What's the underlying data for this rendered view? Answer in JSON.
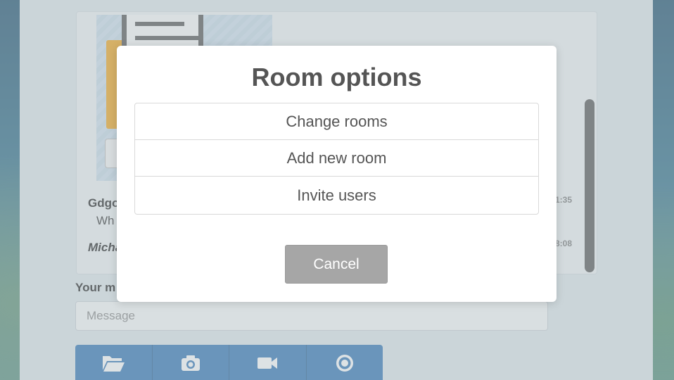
{
  "chat": {
    "messages": [
      {
        "sender": "Gdgo",
        "text": "Wh",
        "time": "1:35"
      },
      {
        "sender": "Micha",
        "time": "8:08"
      }
    ]
  },
  "compose": {
    "label": "Your m",
    "placeholder": "Message"
  },
  "toolbar": {
    "icons": [
      "folder-open-icon",
      "camera-icon",
      "video-camera-icon",
      "record-icon"
    ]
  },
  "modal": {
    "title": "Room options",
    "options": [
      {
        "label": "Change rooms"
      },
      {
        "label": "Add new room"
      },
      {
        "label": "Invite users"
      }
    ],
    "cancel_label": "Cancel"
  },
  "colors": {
    "toolbar_bg": "#2f74b5",
    "folder": "#f0a51c",
    "cancel_bg": "#a6a6a6",
    "title_text": "#555555"
  }
}
